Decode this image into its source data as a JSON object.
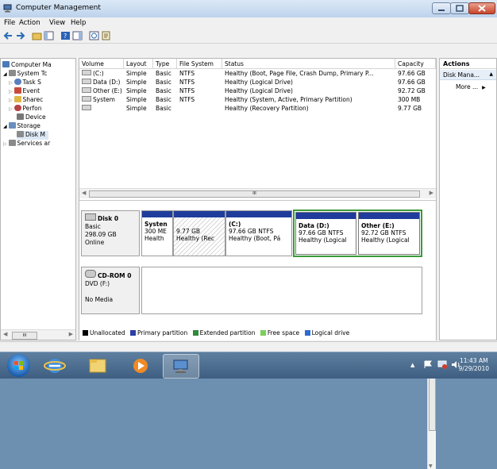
{
  "window": {
    "title": "Computer Management"
  },
  "menu": [
    "File",
    "Action",
    "View",
    "Help"
  ],
  "tree": {
    "items": [
      "Computer Ma",
      "System Tc",
      "Task S",
      "Event",
      "Sharec",
      "Perfon",
      "Device",
      "Storage",
      "Disk M",
      "Services ar"
    ]
  },
  "volumes": {
    "columns": [
      "Volume",
      "Layout",
      "Type",
      "File System",
      "Status",
      "Capacity"
    ],
    "rows": [
      [
        "(C:)",
        "Simple",
        "Basic",
        "NTFS",
        "Healthy (Boot, Page File, Crash Dump, Primary P...",
        "97.66 GB"
      ],
      [
        "Data (D:)",
        "Simple",
        "Basic",
        "NTFS",
        "Healthy (Logical Drive)",
        "97.66 GB"
      ],
      [
        "Other (E:)",
        "Simple",
        "Basic",
        "NTFS",
        "Healthy (Logical Drive)",
        "92.72 GB"
      ],
      [
        "System",
        "Simple",
        "Basic",
        "NTFS",
        "Healthy (System, Active, Primary Partition)",
        "300 MB"
      ],
      [
        "",
        "Simple",
        "Basic",
        "",
        "Healthy (Recovery Partition)",
        "9.77 GB"
      ]
    ],
    "scroll_label": "III"
  },
  "disk0": {
    "name": "Disk 0",
    "type": "Basic",
    "size": "298.09 GB",
    "status": "Online"
  },
  "partitions": [
    {
      "name": "Systen",
      "line2": "300 ME",
      "line3": "Health"
    },
    {
      "name": "",
      "line2": "9.77 GB",
      "line3": "Healthy (Rec"
    },
    {
      "name": "(C:)",
      "line2": "97.66 GB NTFS",
      "line3": "Healthy (Boot, Pá"
    },
    {
      "name": "Data  (D:)",
      "line2": "97.66 GB NTFS",
      "line3": "Healthy (Logical"
    },
    {
      "name": "Other  (E:)",
      "line2": "92.72 GB NTFS",
      "line3": "Healthy (Logical"
    }
  ],
  "cdrom": {
    "name": "CD-ROM 0",
    "drive": "DVD (F:)",
    "media": "No Media"
  },
  "legend": [
    {
      "label": "Unallocated",
      "color": "#000000"
    },
    {
      "label": "Primary partition",
      "color": "#2b3fa6"
    },
    {
      "label": "Extended partition",
      "color": "#2e8b3a"
    },
    {
      "label": "Free space",
      "color": "#7ccf5a"
    },
    {
      "label": "Logical drive",
      "color": "#2d6bd1"
    }
  ],
  "actions": {
    "header": "Actions",
    "section": "Disk Mana...",
    "more": "More ..."
  },
  "tree_scroll_label": "III",
  "clock": {
    "time": "11:43 AM",
    "date": "9/29/2010"
  },
  "colors": {
    "primary_bar": "#1f3c9c",
    "selection_green": "#3a9a3a",
    "taskbar": "#4a6b8e"
  }
}
